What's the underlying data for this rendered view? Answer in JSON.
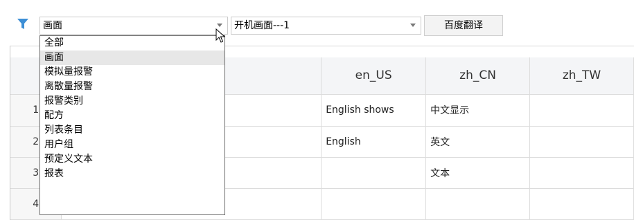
{
  "toolbar": {
    "category_select": {
      "value": "画面"
    },
    "item_select": {
      "value": "开机画面---1"
    },
    "translate_button": "百度翻译"
  },
  "dropdown": {
    "items": [
      "全部",
      "画面",
      "模拟量报警",
      "离散量报警",
      "报警类别",
      "配方",
      "列表条目",
      "用户组",
      "预定义文本",
      "报表"
    ],
    "selected_index": 1
  },
  "grid": {
    "columns": [
      "en_US",
      "zh_CN",
      "zh_TW"
    ],
    "rows": [
      {
        "num": "1",
        "en_US": "English shows",
        "zh_CN": "中文显示",
        "zh_TW": ""
      },
      {
        "num": "2",
        "en_US": "English",
        "zh_CN": "英文",
        "zh_TW": ""
      },
      {
        "num": "3",
        "en_US": "",
        "zh_CN": "文本",
        "zh_TW": ""
      },
      {
        "num": "4",
        "en_US": "",
        "zh_CN": "",
        "zh_TW": ""
      }
    ]
  },
  "colors": {
    "filter_icon": "#3d8fd6",
    "selected_item_bg": "#e7e7e7"
  }
}
